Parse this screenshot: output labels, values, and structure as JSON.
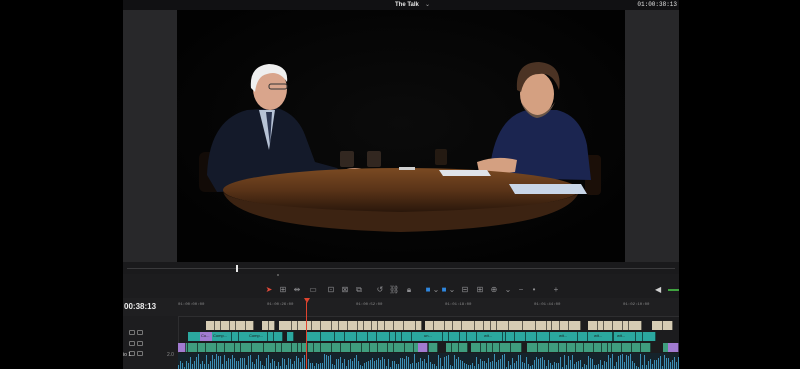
{
  "titlebar": {
    "project_title": "The Talk",
    "timecode": "01:00:38:13"
  },
  "timeline": {
    "current_timecode": "00:38:13",
    "ruler_labels": [
      "01:00:00:00",
      "01:00:26:00",
      "01:00:52:00",
      "01:01:18:00",
      "01:01:44:00",
      "01:02:10:00"
    ],
    "audio_track_label": "io 1",
    "audio_track_number": "2.0"
  },
  "clips": {
    "v2_labels": [
      "Co...",
      "Comp...",
      "Comp...",
      "un...",
      "wit...",
      "wit...",
      "wit...",
      "wit..."
    ]
  },
  "icons": {
    "selection": "arrow-pointer-icon",
    "trim": "trim-icon",
    "snap": "magnet-icon",
    "link": "link-icon",
    "lock": "lock-icon",
    "flag": "flag-icon",
    "marker": "marker-icon",
    "zoom": "zoom-icon",
    "volume": "speaker-icon"
  },
  "colors": {
    "playhead": "#e0442f",
    "video_clip_v3": "#d6ccb4",
    "video_clip_v2": "#2ba89f",
    "video_clip_v1": "#3f9d7e",
    "purple_clip": "#a27bd1",
    "audio_wave": "#3d8fb5",
    "accent_blue": "#2e86de"
  }
}
